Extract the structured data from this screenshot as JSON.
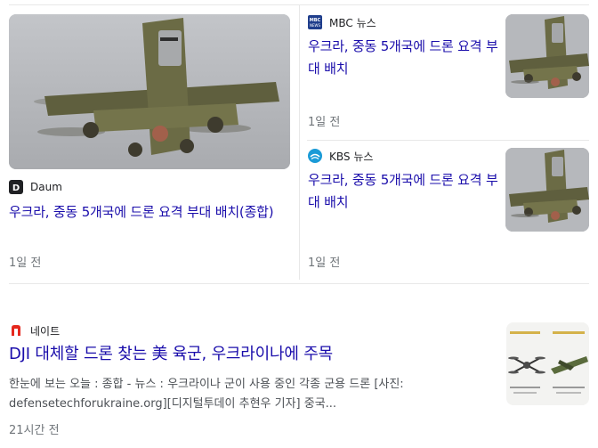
{
  "cards": [
    {
      "source": "Daum",
      "logo_icon": "daum-logo-icon",
      "headline": "우크라, 중동 5개국에 드론 요격 부대 배치(종합)",
      "age": "1일 전"
    },
    {
      "source": "MBC 뉴스",
      "logo_icon": "mbc-logo-icon",
      "logo_text": "MBC NEWS",
      "headline": "우크라, 중동 5개국에 드론 요격 부대 배치",
      "age": "1일 전"
    },
    {
      "source": "KBS 뉴스",
      "logo_icon": "kbs-logo-icon",
      "headline": "우크라, 중동 5개국에 드론 요격 부대 배치",
      "age": "1일 전"
    },
    {
      "source": "네이트",
      "logo_icon": "nate-logo-icon",
      "headline": "DJI 대체할 드론 찾는 美 육군, 우크라이나에 주목",
      "snippet": "한눈에 보는 오늘 : 종합 - 뉴스 : 우크라이나 군이 사용 중인 각종 군용 드론 [사진: defensetechforukraine.org][디지털투데이 추현우 기자] 중국...",
      "age": "21시간 전"
    }
  ],
  "colors": {
    "headline": "#1a0dab",
    "meta": "#70757a",
    "daum_logo": "#202124",
    "mbc_logo": "#1f3e8c",
    "kbs_logo": "#1b9bd7",
    "nate_logo": "#e5281e"
  }
}
